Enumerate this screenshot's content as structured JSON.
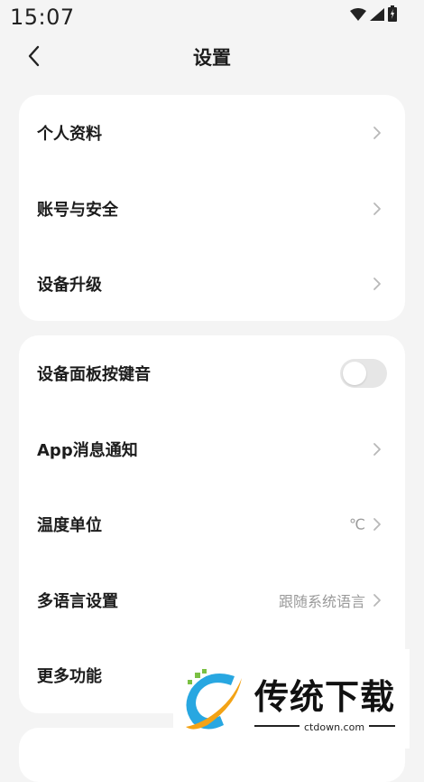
{
  "status_bar": {
    "time": "15:07"
  },
  "header": {
    "title": "设置"
  },
  "card1": {
    "items": [
      {
        "label": "个人资料"
      },
      {
        "label": "账号与安全"
      },
      {
        "label": "设备升级"
      }
    ]
  },
  "card2": {
    "items": [
      {
        "label": "设备面板按键音",
        "toggle_on": false
      },
      {
        "label": "App消息通知"
      },
      {
        "label": "温度单位",
        "value": "℃"
      },
      {
        "label": "多语言设置",
        "value": "跟随系统语言"
      },
      {
        "label": "更多功能"
      }
    ]
  },
  "watermark": {
    "brand": "传统下载",
    "domain": "ctdown.com"
  },
  "colors": {
    "background": "#f4f4f4",
    "card": "#ffffff",
    "chevron": "#b8b8b8",
    "value_text": "#9a9a9a",
    "toggle_off": "#e6e6e6"
  }
}
